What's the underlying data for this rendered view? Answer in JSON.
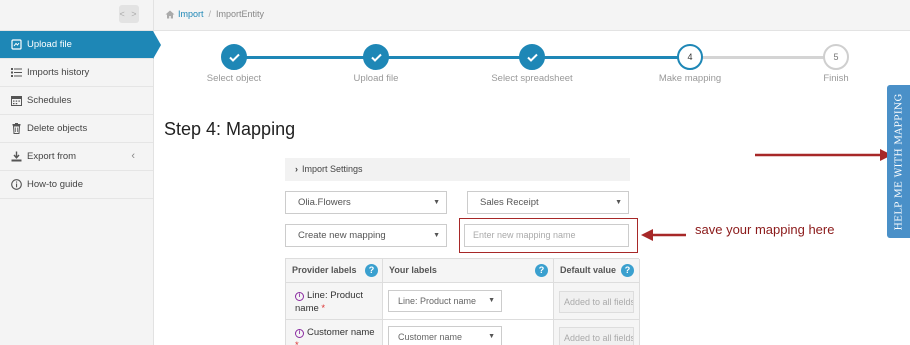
{
  "breadcrumb": {
    "home": "Import",
    "current": "ImportEntity"
  },
  "sidebar": {
    "toggle": "< >",
    "items": [
      {
        "label": "Upload file",
        "icon": "upload-file-icon",
        "active": true
      },
      {
        "label": "Imports history",
        "icon": "list-icon"
      },
      {
        "label": "Schedules",
        "icon": "calendar-icon"
      },
      {
        "label": "Delete objects",
        "icon": "trash-icon"
      },
      {
        "label": "Export from",
        "icon": "download-icon",
        "chevron": "‹"
      },
      {
        "label": "How-to guide",
        "icon": "info-icon"
      }
    ]
  },
  "stepper": {
    "steps": [
      {
        "label": "Select object",
        "state": "done"
      },
      {
        "label": "Upload file",
        "state": "done"
      },
      {
        "label": "Select spreadsheet",
        "state": "done"
      },
      {
        "label": "Make mapping",
        "state": "current",
        "number": "4"
      },
      {
        "label": "Finish",
        "state": "todo",
        "number": "5"
      }
    ]
  },
  "main": {
    "heading": "Step 4: Mapping",
    "settings_toggle": "Import Settings",
    "provider_select": "Olia.Flowers",
    "object_select": "Sales Receipt",
    "mapping_select": "Create new mapping",
    "mapping_name_placeholder": "Enter new mapping name",
    "table": {
      "headers": {
        "provider": "Provider labels",
        "yours": "Your labels",
        "default": "Default value"
      },
      "help_glyph": "?",
      "rows": [
        {
          "provider": "Line: Product name",
          "required": "*",
          "yours": "Line: Product name",
          "default_placeholder": "Added to all fields"
        },
        {
          "provider": "Customer name",
          "required": "*",
          "yours": "Customer name",
          "default_placeholder": "Added to all fields"
        }
      ]
    }
  },
  "annotation": {
    "text": "save your mapping here",
    "color": "#8b1a1a"
  },
  "help_tab": {
    "label": "HELP ME WITH MAPPING"
  },
  "colors": {
    "accent": "#1e87b6",
    "help_tab": "#4a90c8",
    "annotation": "#a72828"
  }
}
